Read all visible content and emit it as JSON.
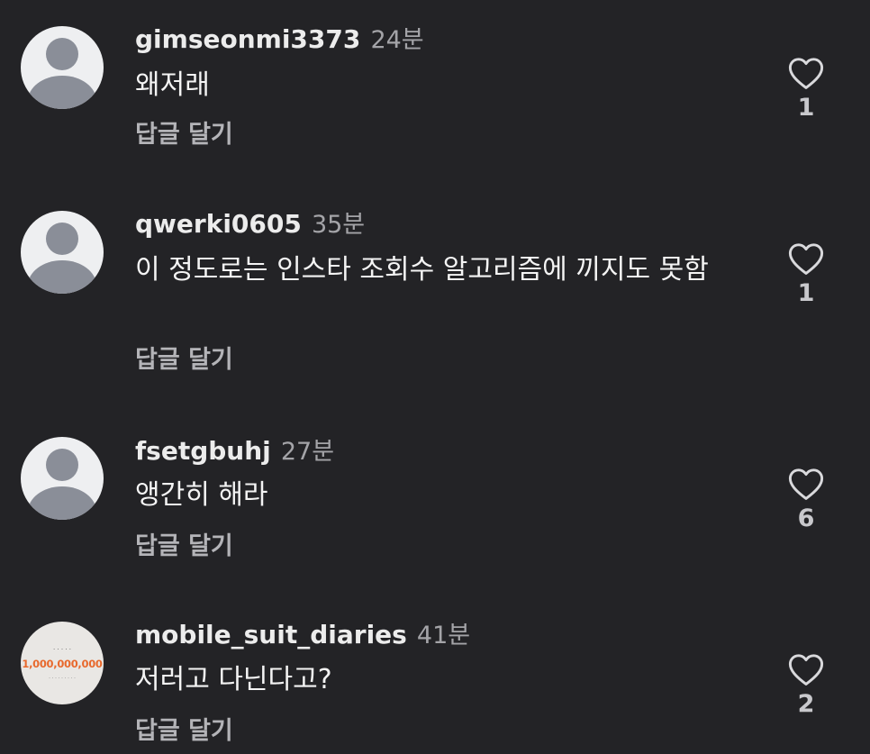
{
  "comments": [
    {
      "username": "gimseonmi3373",
      "time": "24분",
      "text": "왜저래",
      "reply_label": "답글 달기",
      "like_count": "1",
      "avatar": "default-avatar-icon"
    },
    {
      "username": "qwerki0605",
      "time": "35분",
      "text": "이 정도로는 인스타 조회수 알고리즘에  끼지도 못함",
      "reply_label": "답글 달기",
      "like_count": "1",
      "avatar": "default-avatar-icon"
    },
    {
      "username": "fsetgbuhj",
      "time": "27분",
      "text": "앵간히 해라",
      "reply_label": "답글 달기",
      "like_count": "6",
      "avatar": "default-avatar-icon"
    },
    {
      "username": "mobile_suit_diaries",
      "time": "41분",
      "text": "저러고 다닌다고?",
      "reply_label": "답글 달기",
      "like_count": "2",
      "avatar": "profile-photo"
    }
  ],
  "colors": {
    "background": "#232326",
    "username": "#ececec",
    "secondary_text": "#a4a4a8",
    "avatar_placeholder": "#8a8e98"
  }
}
